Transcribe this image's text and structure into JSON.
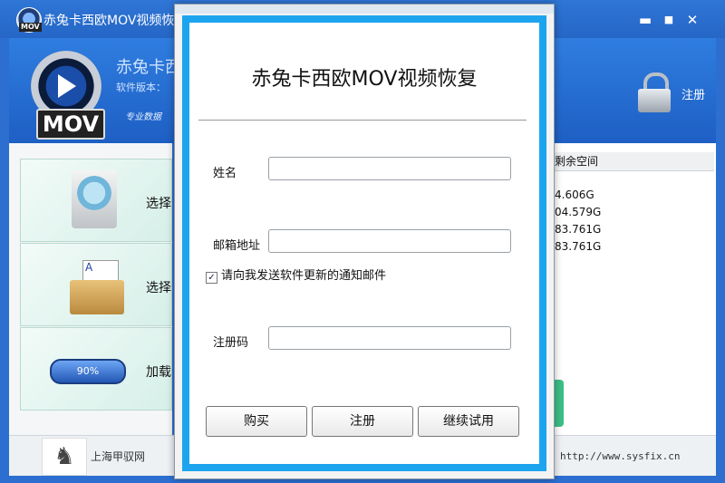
{
  "window": {
    "title": "赤兔卡西欧MOV视频恢复",
    "minimize_glyph": "▬",
    "maximize_glyph": "■",
    "close_glyph": "✕"
  },
  "logo": {
    "label": "MOV"
  },
  "header": {
    "app_name": "赤兔卡西",
    "version_label": "软件版本：",
    "slogan": "专业数据",
    "register_label": "注册"
  },
  "left_panel": {
    "cards": [
      {
        "label": "选择"
      },
      {
        "label": "选择"
      },
      {
        "label": "加载",
        "progress_text": "90%",
        "progress": 0.9
      }
    ],
    "folder_letter": "A"
  },
  "right_panel": {
    "column_header": "剩余空间",
    "values": [
      "4.606G",
      "04.579G",
      "83.761G",
      "83.761G"
    ]
  },
  "footer": {
    "company": "上海甲驭网",
    "url": "http://www.sysfix.cn"
  },
  "dialog": {
    "title": "赤兔卡西欧MOV视频恢复",
    "name_label": "姓名",
    "email_label": "邮箱地址",
    "checkbox_label": "请向我发送软件更新的通知邮件",
    "checkbox_checked": true,
    "code_label": "注册码",
    "buttons": {
      "buy": "购买",
      "register": "注册",
      "trial": "继续试用"
    }
  },
  "colors": {
    "title_blue": "#2566c6",
    "dialog_border": "#1da4ef",
    "green_button": "#3bbf85"
  }
}
